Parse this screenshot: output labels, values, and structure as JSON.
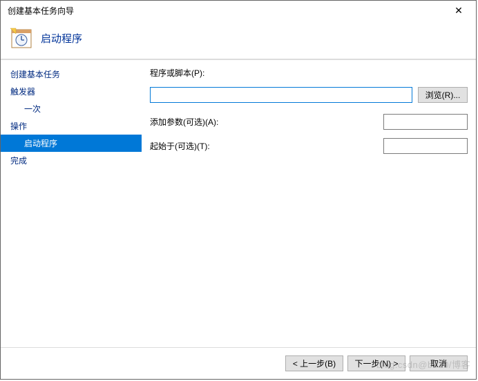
{
  "window": {
    "title": "创建基本任务向导"
  },
  "header": {
    "title": "启动程序"
  },
  "sidebar": {
    "items": [
      {
        "label": "创建基本任务"
      },
      {
        "label": "触发器"
      },
      {
        "label": "一次"
      },
      {
        "label": "操作"
      },
      {
        "label": "启动程序"
      },
      {
        "label": "完成"
      }
    ]
  },
  "form": {
    "program_label": "程序或脚本(P):",
    "program_value": "",
    "browse_label": "浏览(R)...",
    "args_label": "添加参数(可选)(A):",
    "args_value": "",
    "startin_label": "起始于(可选)(T):",
    "startin_value": ""
  },
  "footer": {
    "back": "< 上一步(B)",
    "next": "下一步(N) >",
    "cancel": "取消"
  },
  "watermark": "blog.csdn@b510/博客"
}
